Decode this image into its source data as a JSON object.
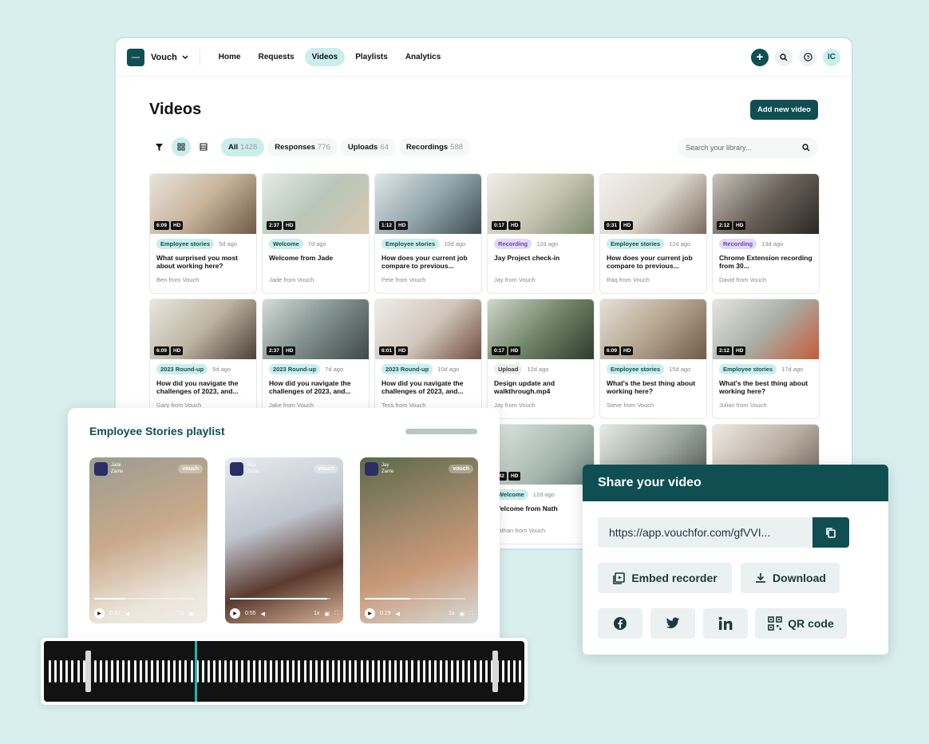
{
  "nav": {
    "logo_text": "vouch",
    "brand": "Vouch",
    "links": [
      "Home",
      "Requests",
      "Videos",
      "Playlists",
      "Analytics"
    ],
    "active_link": "Videos",
    "avatar": "IC"
  },
  "page": {
    "title": "Videos",
    "add_button": "Add new video",
    "search_placeholder": "Search your library..."
  },
  "filters": [
    {
      "label": "All",
      "count": "1428"
    },
    {
      "label": "Responses",
      "count": "776"
    },
    {
      "label": "Uploads",
      "count": "64"
    },
    {
      "label": "Recordings",
      "count": "588"
    }
  ],
  "videos": [
    {
      "duration": "6:09",
      "quality": "HD",
      "tag": "Employee stories",
      "ago": "5d ago",
      "title": "What surprised you most about working here?",
      "author": "Ben from Vouch"
    },
    {
      "duration": "2:37",
      "quality": "HD",
      "tag": "Welcome",
      "ago": "7d ago",
      "title": "Welcome from Jade",
      "author": "Jade from Vouch"
    },
    {
      "duration": "1:12",
      "quality": "HD",
      "tag": "Employee stories",
      "ago": "10d ago",
      "title": "How does your current job compare to previous...",
      "author": "Pete from Vouch"
    },
    {
      "duration": "0:17",
      "quality": "HD",
      "tag": "Recording",
      "ago": "12d ago",
      "title": "Jay Project check-in",
      "author": "Jay from Vouch"
    },
    {
      "duration": "0:31",
      "quality": "HD",
      "tag": "Employee stories",
      "ago": "12d ago",
      "title": "How does your current job compare to previous...",
      "author": "Raq from Vouch"
    },
    {
      "duration": "2:12",
      "quality": "HD",
      "tag": "Recording",
      "ago": "13d ago",
      "title": "Chrome Extension recording from 30...",
      "author": "David from Vouch"
    },
    {
      "duration": "6:09",
      "quality": "HD",
      "tag": "2023 Round-up",
      "ago": "5d ago",
      "title": "How did you navigate the challenges of 2023, and...",
      "author": "Gary from Vouch"
    },
    {
      "duration": "2:37",
      "quality": "HD",
      "tag": "2023 Round-up",
      "ago": "7d ago",
      "title": "How did you navigate the challenges of 2023, and...",
      "author": "Jake from Vouch"
    },
    {
      "duration": "6:01",
      "quality": "HD",
      "tag": "2023 Round-up",
      "ago": "10d ago",
      "title": "How did you navigate the challenges of 2023, and...",
      "author": "Tess from Vouch"
    },
    {
      "duration": "0:17",
      "quality": "HD",
      "tag": "Upload",
      "ago": "12d ago",
      "title": "Design update and walkthrough.mp4",
      "author": "Jay from Vouch"
    },
    {
      "duration": "6:09",
      "quality": "HD",
      "tag": "Employee stories",
      "ago": "15d ago",
      "title": "What's the best thing about working here?",
      "author": "Steve from Vouch"
    },
    {
      "duration": "2:12",
      "quality": "HD",
      "tag": "Employee stories",
      "ago": "17d ago",
      "title": "What's the best thing about working here?",
      "author": "Julian from Vouch"
    }
  ],
  "partial_card": {
    "duration": "0:42",
    "quality": "HD",
    "tag": "Welcome",
    "ago": "12d ago",
    "title": "Welcome from Nath",
    "author": "Nathan from Vouch"
  },
  "playlist": {
    "title": "Employee Stories playlist",
    "videos": [
      {
        "name": "Jade",
        "company": "Zante",
        "brand": "vouch",
        "time": "0:32",
        "speed": "1x",
        "progress": 0.3
      },
      {
        "name": "Tess",
        "company": "Zante",
        "brand": "vouch",
        "time": "0:55",
        "speed": "1x",
        "progress": 0.97
      },
      {
        "name": "Jay",
        "company": "Zante",
        "brand": "vouch",
        "time": "0:29",
        "speed": "1x",
        "progress": 0.45
      }
    ]
  },
  "share": {
    "title": "Share your video",
    "url": "https://app.vouchfor.com/gfVVI...",
    "embed": "Embed recorder",
    "download": "Download",
    "qr": "QR code"
  }
}
